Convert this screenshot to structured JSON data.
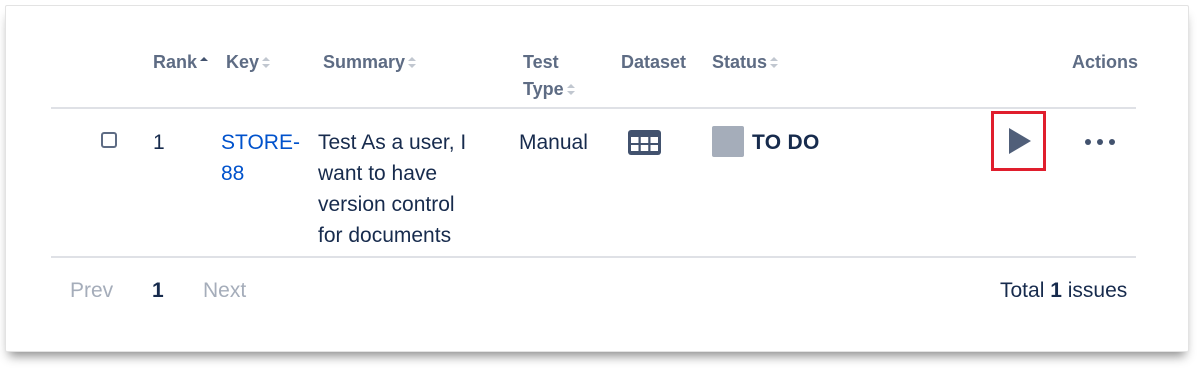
{
  "table": {
    "headers": {
      "rank": "Rank",
      "key": "Key",
      "summary": "Summary",
      "test_type_line1": "Test",
      "test_type_line2": "Type",
      "dataset": "Dataset",
      "status": "Status",
      "actions": "Actions"
    },
    "rows": [
      {
        "rank": "1",
        "key_line1": "STORE-",
        "key_line2": "88",
        "summary_lines": [
          "Test As a user, I",
          "want to have",
          "version control",
          "for documents"
        ],
        "test_type": "Manual",
        "dataset_icon": "table-grid-icon",
        "status": "TO DO",
        "status_color": "#a5adba",
        "run_icon": "play-icon",
        "more_icon": "more-horizontal-icon"
      }
    ]
  },
  "pagination": {
    "prev": "Prev",
    "current": "1",
    "next": "Next",
    "total_prefix": "Total",
    "total_count": "1",
    "total_suffix": "issues"
  },
  "colors": {
    "link": "#0052cc",
    "highlight_border": "#e01e2d",
    "header_text": "#5e6c84"
  }
}
